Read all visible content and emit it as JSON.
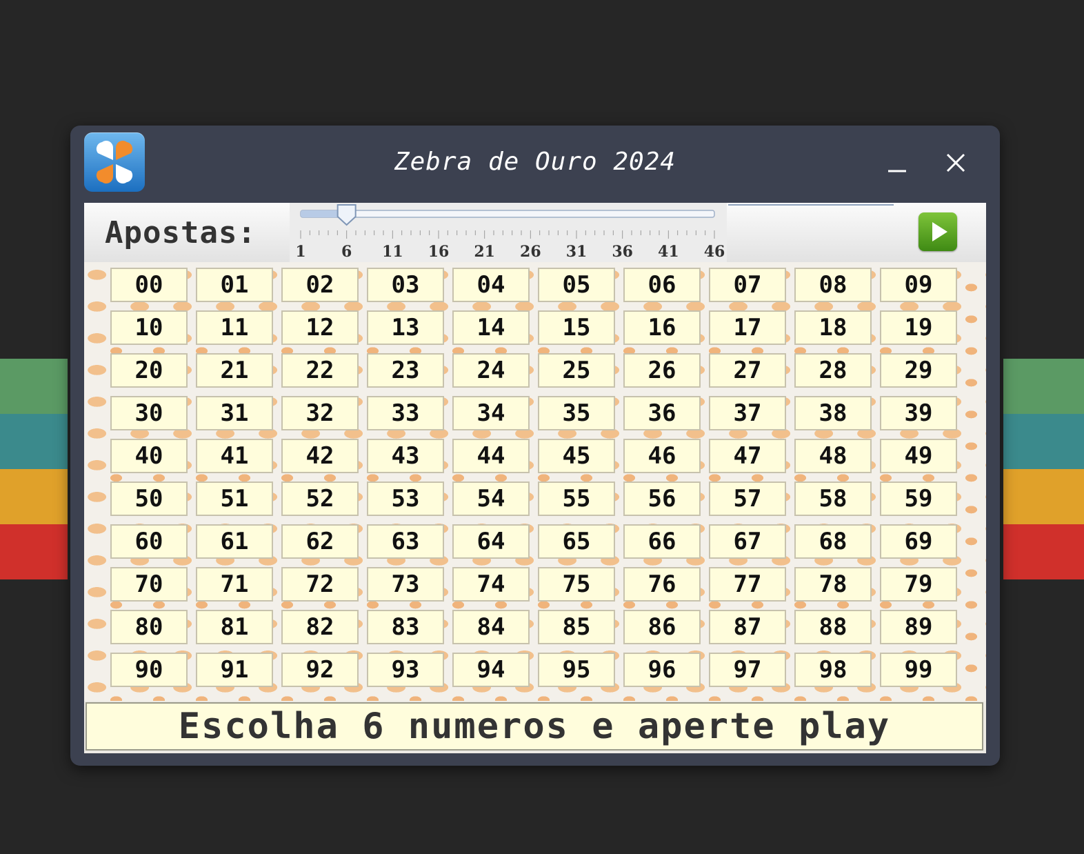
{
  "background": {
    "stripe_colors": [
      "#5b9a64",
      "#3b8a8c",
      "#e0a12a",
      "#d0302b"
    ]
  },
  "window": {
    "title": "Zebra de Ouro 2024",
    "app_icon": "four-leaf-clover-icon",
    "minimize_icon": "minimize-icon",
    "close_icon": "close-icon"
  },
  "toolbar": {
    "label": "Apostas:",
    "slider": {
      "min": 1,
      "max": 46,
      "value": 6,
      "tick_labels": [
        "1",
        "6",
        "11",
        "16",
        "21",
        "26",
        "31",
        "36",
        "41",
        "46"
      ]
    },
    "play_icon": "play-icon",
    "accent_color": "#4f9a1f"
  },
  "numbers": [
    "00",
    "01",
    "02",
    "03",
    "04",
    "05",
    "06",
    "07",
    "08",
    "09",
    "10",
    "11",
    "12",
    "13",
    "14",
    "15",
    "16",
    "17",
    "18",
    "19",
    "20",
    "21",
    "22",
    "23",
    "24",
    "25",
    "26",
    "27",
    "28",
    "29",
    "30",
    "31",
    "32",
    "33",
    "34",
    "35",
    "36",
    "37",
    "38",
    "39",
    "40",
    "41",
    "42",
    "43",
    "44",
    "45",
    "46",
    "47",
    "48",
    "49",
    "50",
    "51",
    "52",
    "53",
    "54",
    "55",
    "56",
    "57",
    "58",
    "59",
    "60",
    "61",
    "62",
    "63",
    "64",
    "65",
    "66",
    "67",
    "68",
    "69",
    "70",
    "71",
    "72",
    "73",
    "74",
    "75",
    "76",
    "77",
    "78",
    "79",
    "80",
    "81",
    "82",
    "83",
    "84",
    "85",
    "86",
    "87",
    "88",
    "89",
    "90",
    "91",
    "92",
    "93",
    "94",
    "95",
    "96",
    "97",
    "98",
    "99"
  ],
  "status": {
    "message": "Escolha 6 numeros e aperte play"
  }
}
